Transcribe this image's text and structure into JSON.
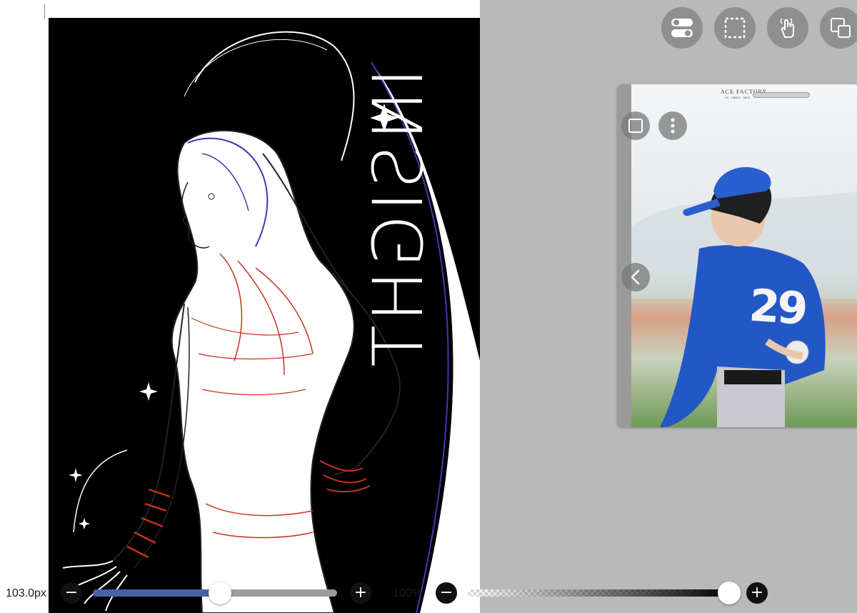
{
  "canvas": {
    "artwork_title": "INSIGHT",
    "background_color": "#000000",
    "line_colors": [
      "#ffffff",
      "#c8321e",
      "#3b3bb0"
    ]
  },
  "toolbar": {
    "buttons": [
      {
        "name": "toggle-switch-icon"
      },
      {
        "name": "selection-icon"
      },
      {
        "name": "gesture-hand-icon"
      },
      {
        "name": "transform-icon"
      }
    ]
  },
  "reference_panel": {
    "photo_brand": "ACE FACTORY",
    "photo_brand_sub": "24 · HIBISC · NEW",
    "jersey_number": "29",
    "icons": [
      "square-outline-icon",
      "more-vertical-icon",
      "chevron-left-icon"
    ]
  },
  "brush_size": {
    "label": "103.0px",
    "minus": "−",
    "plus": "+",
    "level": 0.52
  },
  "opacity": {
    "label": "100%",
    "minus": "−",
    "plus": "+",
    "level": 1.0
  },
  "colors": {
    "accent": "#4763a7",
    "toolbar_button": "#8f8f8f",
    "workspace": "#b9b9b9"
  }
}
